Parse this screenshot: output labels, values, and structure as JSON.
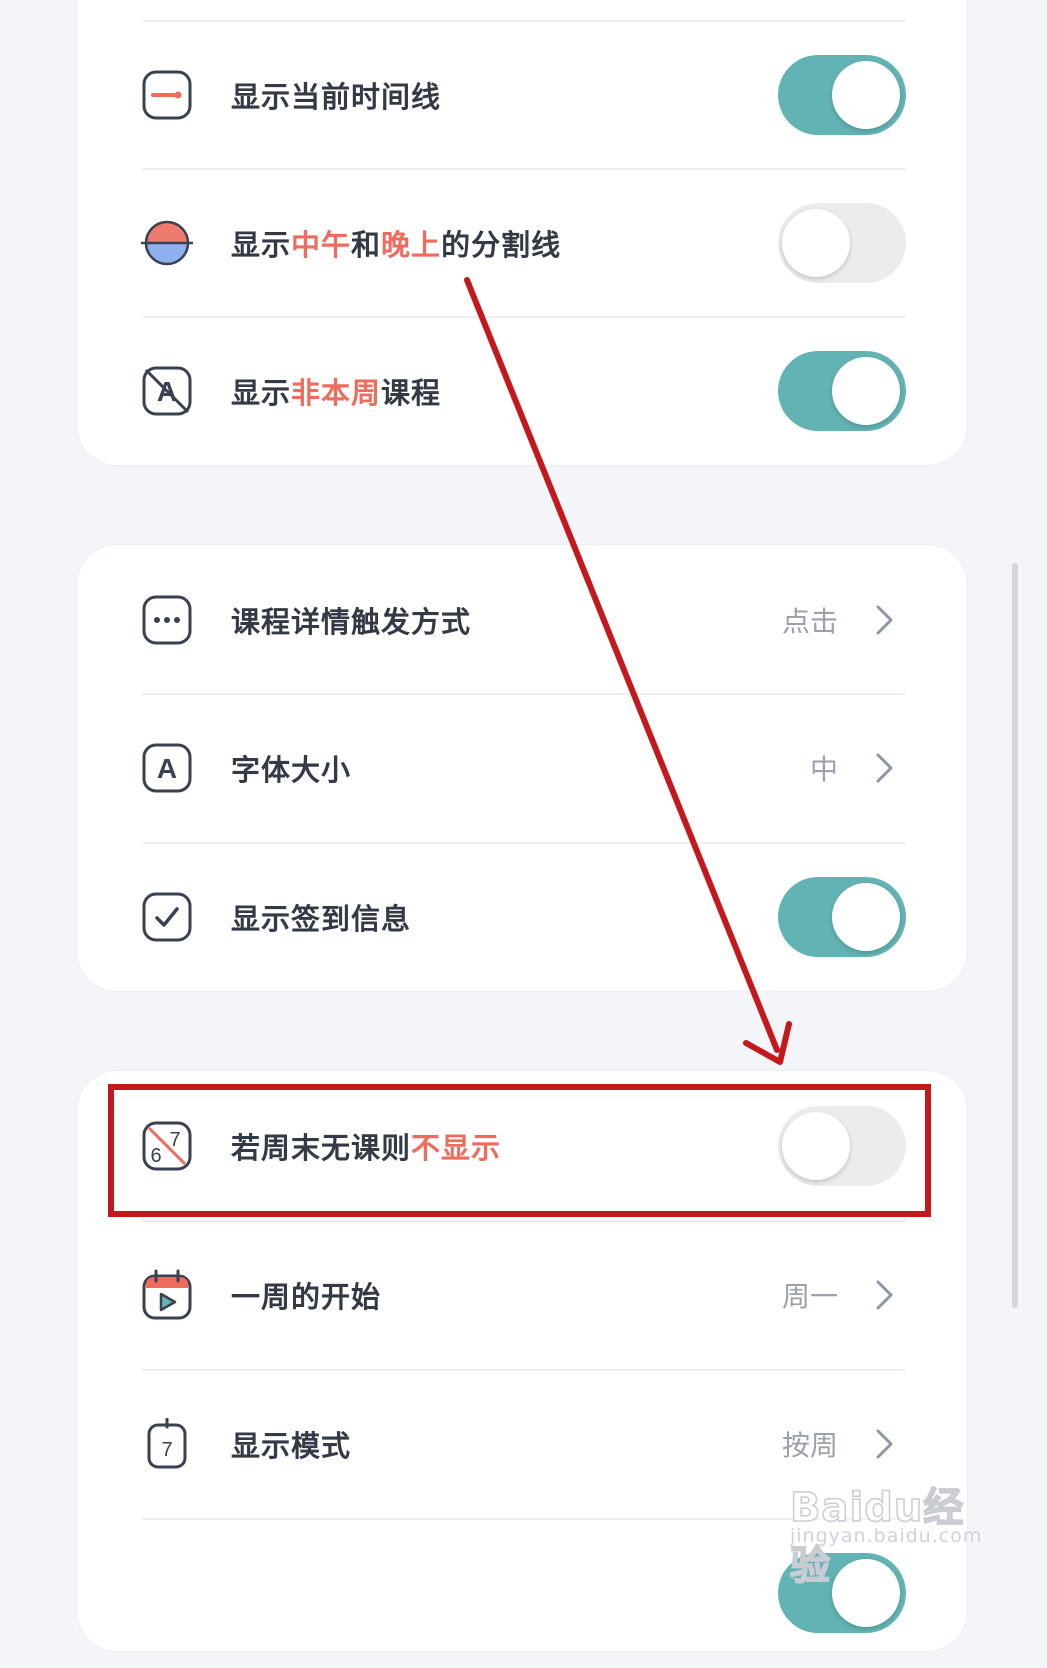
{
  "settings": {
    "show_time_line": {
      "label": "显示当前时间线",
      "on": true
    },
    "show_divider": {
      "label_parts": [
        "显示",
        "中午",
        "和",
        "晚上",
        "的分割线"
      ],
      "on": false
    },
    "show_non_week": {
      "label_parts": [
        "显示",
        "非本周",
        "课程"
      ],
      "on": true
    },
    "detail_trigger": {
      "label": "课程详情触发方式",
      "value": "点击"
    },
    "font_size": {
      "label": "字体大小",
      "value": "中"
    },
    "show_checkin": {
      "label": "显示签到信息",
      "on": true
    },
    "hide_weekend": {
      "label_parts": [
        "若周末无课则",
        "不显示"
      ],
      "on": false
    },
    "week_start": {
      "label": "一周的开始",
      "value": "周一"
    },
    "display_mode": {
      "label": "显示模式",
      "value": "按周"
    },
    "next_partial": {
      "on": true
    }
  },
  "icons": {
    "time_line": "timeline-icon",
    "divider": "half-circle-icon",
    "non_week": "letter-a-slash-icon",
    "detail": "ellipsis-icon",
    "font": "letter-a-icon",
    "checkin": "checkmark-icon",
    "weekend": "six-seven-slash-icon",
    "week_start": "calendar-play-icon",
    "display_mode": "calendar-seven-icon"
  },
  "icon_glyphs": {
    "font": "A",
    "non_week": "A",
    "weekend_a": "6",
    "weekend_b": "7",
    "display_mode": "7"
  },
  "colors": {
    "toggle_on": "#62b4b4",
    "toggle_off": "#ececec",
    "highlight_text": "#ef6b5d",
    "annotation_red": "#c4181c"
  },
  "watermark": {
    "main": "Baidu经验",
    "sub": "jingyan.baidu.com"
  }
}
